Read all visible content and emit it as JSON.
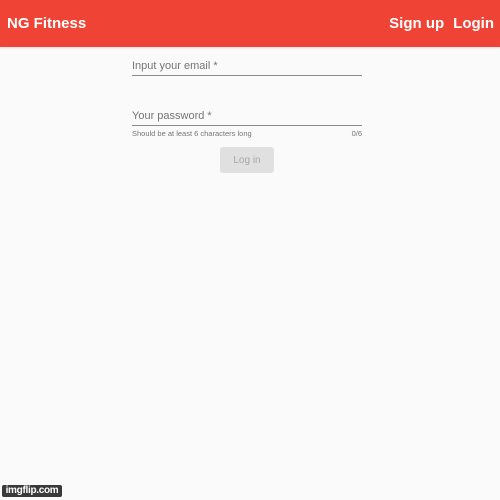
{
  "colors": {
    "toolbar_bg": "#ef4335",
    "toolbar_text": "#ffffff",
    "page_bg": "#fafafa",
    "button_disabled_bg": "#e0e0e0",
    "button_disabled_text": "#a6a6a6"
  },
  "toolbar": {
    "brand": "NG Fitness",
    "signup_label": "Sign up",
    "login_label": "Login"
  },
  "form": {
    "email": {
      "placeholder": "Input your email *",
      "value": ""
    },
    "password": {
      "placeholder": "Your password *",
      "value": "",
      "hint": "Should be at least 6 characters long",
      "counter": "0/6"
    },
    "submit_label": "Log in",
    "submit_disabled": true
  },
  "watermark": {
    "text": "imgflip.com"
  }
}
